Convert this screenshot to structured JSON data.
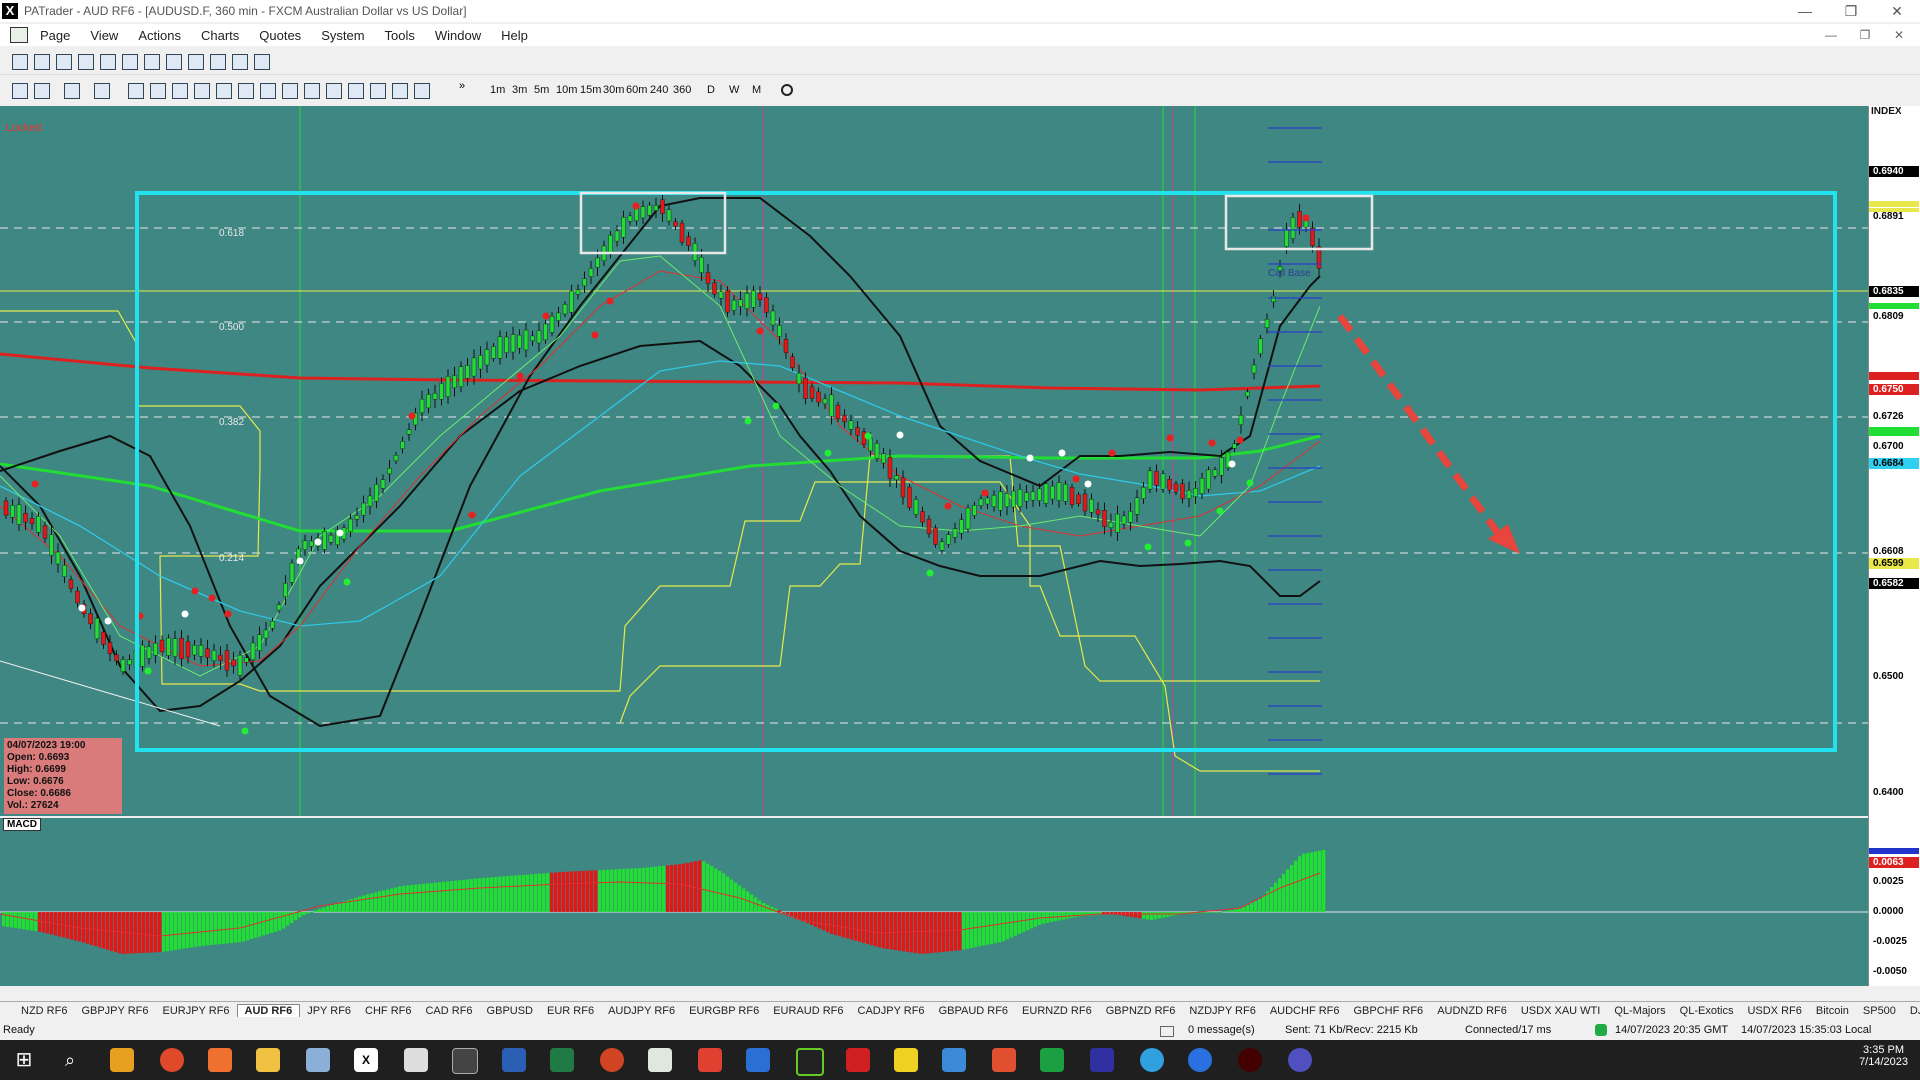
{
  "window": {
    "title": "PATrader - AUD RF6 - [AUDUSD.F, 360 min - FXCM Australian Dollar vs US Dollar]",
    "app_icon": "X"
  },
  "menu": [
    "Page",
    "View",
    "Actions",
    "Charts",
    "Quotes",
    "System",
    "Tools",
    "Window",
    "Help"
  ],
  "timeframes": [
    "1m",
    "3m",
    "5m",
    "10m",
    "15m",
    "30m",
    "60m",
    "240",
    "360",
    "D",
    "W",
    "M"
  ],
  "chart": {
    "locked_label": "Locked",
    "index_label": "INDEX",
    "fib_labels": [
      "0.618",
      "0.500",
      "0.382",
      "0.214"
    ],
    "zone_label": "Call Base",
    "info": {
      "date": "04/07/2023 19:00",
      "open": "Open: 0.6693",
      "high": "High: 0.6699",
      "low": "Low: 0.6676",
      "close": "Close: 0.6686",
      "vol": "Vol.: 27624"
    },
    "price_axis_labels": [
      "0.6940",
      "0.6891",
      "0.6835",
      "0.6809",
      "0.6750",
      "0.6726",
      "0.6700",
      "0.6684",
      "0.6608",
      "0.6599",
      "0.6582",
      "0.6500",
      "0.6400"
    ],
    "macd_label": "MACD",
    "macd_axis_labels": [
      "0.0063",
      "0.0025",
      "0.0000",
      "-0.0025",
      "-0.0050"
    ],
    "colors": {
      "background": "#3e8782",
      "bull": "#22dd33",
      "bear": "#e01818",
      "box": "#23e2f0",
      "arrow": "#e8453c"
    }
  },
  "tabs": [
    "NZD RF6",
    "GBPJPY RF6",
    "EURJPY RF6",
    "AUD RF6",
    "JPY RF6",
    "CHF RF6",
    "CAD RF6",
    "GBPUSD",
    "EUR RF6",
    "AUDJPY RF6",
    "EURGBP RF6",
    "EURAUD RF6",
    "CADJPY RF6",
    "GBPAUD RF6",
    "EURNZD RF6",
    "GBPNZD RF6",
    "NZDJPY RF6",
    "AUDCHF RF6",
    "GBPCHF RF6",
    "AUDNZD RF6",
    "USDX XAU WTI",
    "QL-Majors",
    "QL-Exotics",
    "USDX RF6",
    "Bitcoin",
    "SP500",
    "DJIA"
  ],
  "active_tab": "AUD RF6",
  "status": {
    "ready": "Ready",
    "messages": "0 message(s)",
    "traffic": "Sent: 71 Kb/Recv: 2215 Kb",
    "connection": "Connected/17 ms",
    "gmt": "14/07/2023 20:35 GMT",
    "local": "14/07/2023 15:35:03 Local"
  },
  "taskbar": {
    "time": "3:35 PM",
    "date": "7/14/2023"
  }
}
